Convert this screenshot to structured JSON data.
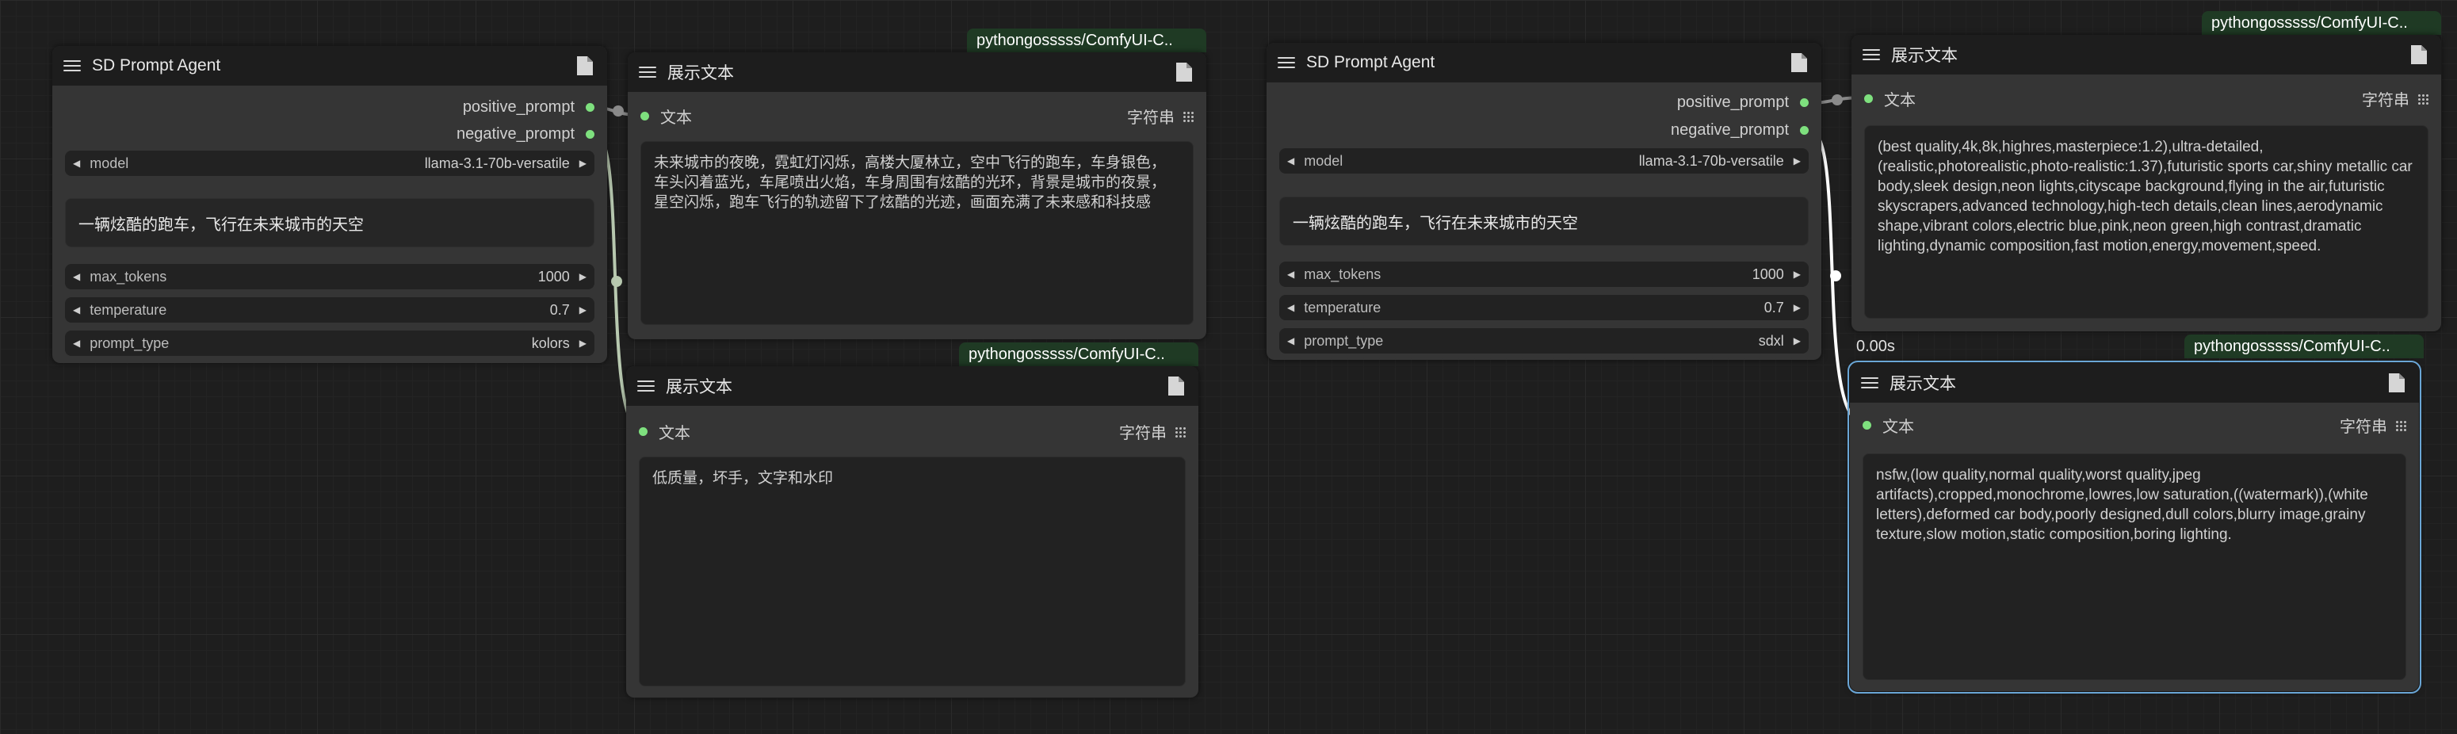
{
  "nodes": {
    "agent1": {
      "title": "SD Prompt Agent",
      "outputs": [
        "positive_prompt",
        "negative_prompt"
      ],
      "model_label": "model",
      "model_value": "llama-3.1-70b-versatile",
      "input_text": "一辆炫酷的跑车，飞行在未来城市的天空",
      "widgets": [
        {
          "name": "max_tokens",
          "value": "1000"
        },
        {
          "name": "temperature",
          "value": "0.7"
        },
        {
          "name": "prompt_type",
          "value": "kolors"
        }
      ]
    },
    "show1": {
      "badge": "pythongosssss/ComfyUI-C..",
      "title": "展示文本",
      "input_label": "文本",
      "type_label": "字符串",
      "text": "未来城市的夜晚，霓虹灯闪烁，高楼大厦林立，空中飞行的跑车，车身银色，车头闪着蓝光，车尾喷出火焰，车身周围有炫酷的光环，背景是城市的夜景，星空闪烁，跑车飞行的轨迹留下了炫酷的光迹，画面充满了未来感和科技感"
    },
    "show2": {
      "badge": "pythongosssss/ComfyUI-C..",
      "title": "展示文本",
      "input_label": "文本",
      "type_label": "字符串",
      "text": "低质量，坏手，文字和水印"
    },
    "agent2": {
      "title": "SD Prompt Agent",
      "outputs": [
        "positive_prompt",
        "negative_prompt"
      ],
      "model_label": "model",
      "model_value": "llama-3.1-70b-versatile",
      "input_text": "一辆炫酷的跑车，飞行在未来城市的天空",
      "widgets": [
        {
          "name": "max_tokens",
          "value": "1000"
        },
        {
          "name": "temperature",
          "value": "0.7"
        },
        {
          "name": "prompt_type",
          "value": "sdxl"
        }
      ]
    },
    "show3": {
      "badge": "pythongosssss/ComfyUI-C..",
      "title": "展示文本",
      "input_label": "文本",
      "type_label": "字符串",
      "text": "(best quality,4k,8k,highres,masterpiece:1.2),ultra-detailed,(realistic,photorealistic,photo-realistic:1.37),futuristic sports car,shiny metallic car body,sleek design,neon lights,cityscape background,flying in the air,futuristic skyscrapers,advanced technology,high-tech details,clean lines,aerodynamic shape,vibrant colors,electric blue,pink,neon green,high contrast,dramatic lighting,dynamic composition,fast motion,energy,movement,speed."
    },
    "show4": {
      "badge": "pythongosssss/ComfyUI-C..",
      "timer": "0.00s",
      "title": "展示文本",
      "input_label": "文本",
      "type_label": "字符串",
      "text": "nsfw,(low quality,normal quality,worst quality,jpeg artifacts),cropped,monochrome,lowres,low saturation,((watermark)),(white letters),deformed car body,poorly designed,dull colors,blurry image,grainy texture,slow motion,static composition,boring lighting."
    }
  },
  "colors": {
    "slot": "#7ee07e",
    "badge_bg": "#1f3a24",
    "selected_outline": "#6aa6d6",
    "wire": "#b8c9b0"
  }
}
